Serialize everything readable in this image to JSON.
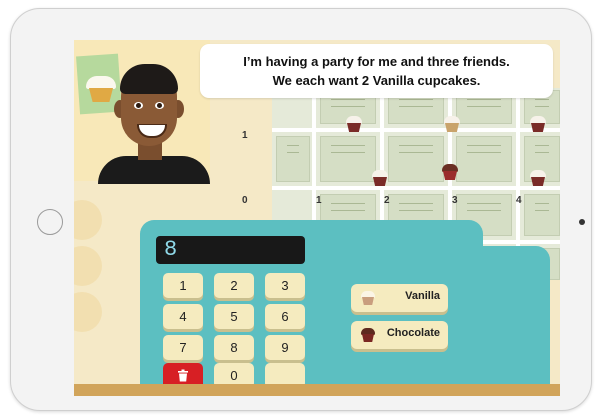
{
  "speech": {
    "line1": "I’m having a party for me and three friends.",
    "line2": "We each want 2 Vanilla cupcakes."
  },
  "map": {
    "row_labels": [
      "1",
      "0"
    ],
    "col_labels": [
      "1",
      "2",
      "3",
      "4"
    ]
  },
  "register": {
    "display_value": "8",
    "keys": [
      "1",
      "2",
      "3",
      "4",
      "5",
      "6",
      "7",
      "8",
      "9",
      "0"
    ],
    "delete_icon": "trash-icon"
  },
  "flavors": {
    "vanilla_label": "Vanilla",
    "chocolate_label": "Chocolate"
  },
  "colors": {
    "register": "#5cbfc1",
    "key": "#f5ebbf",
    "delete_key": "#d71f24",
    "display_text": "#8fd8e8"
  }
}
